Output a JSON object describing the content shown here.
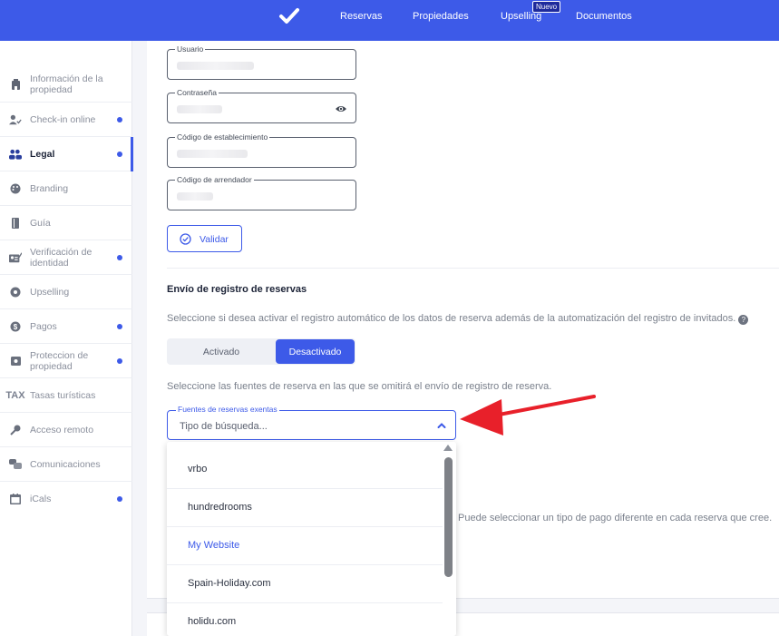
{
  "topbar": {
    "nav": [
      "Reservas",
      "Propiedades",
      "Upselling",
      "Documentos"
    ],
    "new_badge": "Nuevo",
    "logo_icon": "check-icon"
  },
  "sidebar": {
    "items": [
      {
        "label": "Información de la propiedad",
        "icon": "building-icon",
        "dot": false
      },
      {
        "label": "Check-in online",
        "icon": "user-check-icon",
        "dot": true
      },
      {
        "label": "Legal",
        "icon": "legal-users-icon",
        "dot": true,
        "active": true
      },
      {
        "label": "Branding",
        "icon": "palette-icon",
        "dot": false
      },
      {
        "label": "Guía",
        "icon": "book-icon",
        "dot": false
      },
      {
        "label": "Verificación de identidad",
        "icon": "id-card-icon",
        "dot": true
      },
      {
        "label": "Upselling",
        "icon": "gear-badge-icon",
        "dot": false
      },
      {
        "label": "Pagos",
        "icon": "dollar-icon",
        "dot": true
      },
      {
        "label": "Proteccion de propiedad",
        "icon": "shield-icon",
        "dot": true
      },
      {
        "label": "Tasas turísticas",
        "icon": "tax-icon",
        "dot": false,
        "icon_text": "TAX"
      },
      {
        "label": "Acceso remoto",
        "icon": "key-icon",
        "dot": false
      },
      {
        "label": "Comunicaciones",
        "icon": "chat-icon",
        "dot": false
      },
      {
        "label": "iCals",
        "icon": "calendar-icon",
        "dot": true
      }
    ]
  },
  "form": {
    "usuario_label": "Usuario",
    "contrasena_label": "Contraseña",
    "codigo_establecimiento_label": "Código de establecimiento",
    "codigo_arrendador_label": "Código de arrendador",
    "validar_label": "Validar"
  },
  "envio": {
    "title": "Envío de registro de reservas",
    "description": "Seleccione si desea activar el registro automático de los datos de reserva además de la automatización del registro de invitados.",
    "toggle_on": "Activado",
    "toggle_off": "Desactivado",
    "sources_description": "Seleccione las fuentes de reserva en las que se omitirá el envío de registro de reserva.",
    "combo_label": "Fuentes de reservas exentas",
    "combo_placeholder": "Tipo de búsqueda...",
    "options": [
      "vrbo",
      "hundredrooms",
      "My Website",
      "Spain-Holiday.com",
      "holidu.com"
    ],
    "selected_option": "My Website"
  },
  "payment_text": "Puede seleccionar un tipo de pago diferente en cada reserva que cree.",
  "colors": {
    "primary": "#3d5ae8",
    "arrow": "#e8202a"
  }
}
